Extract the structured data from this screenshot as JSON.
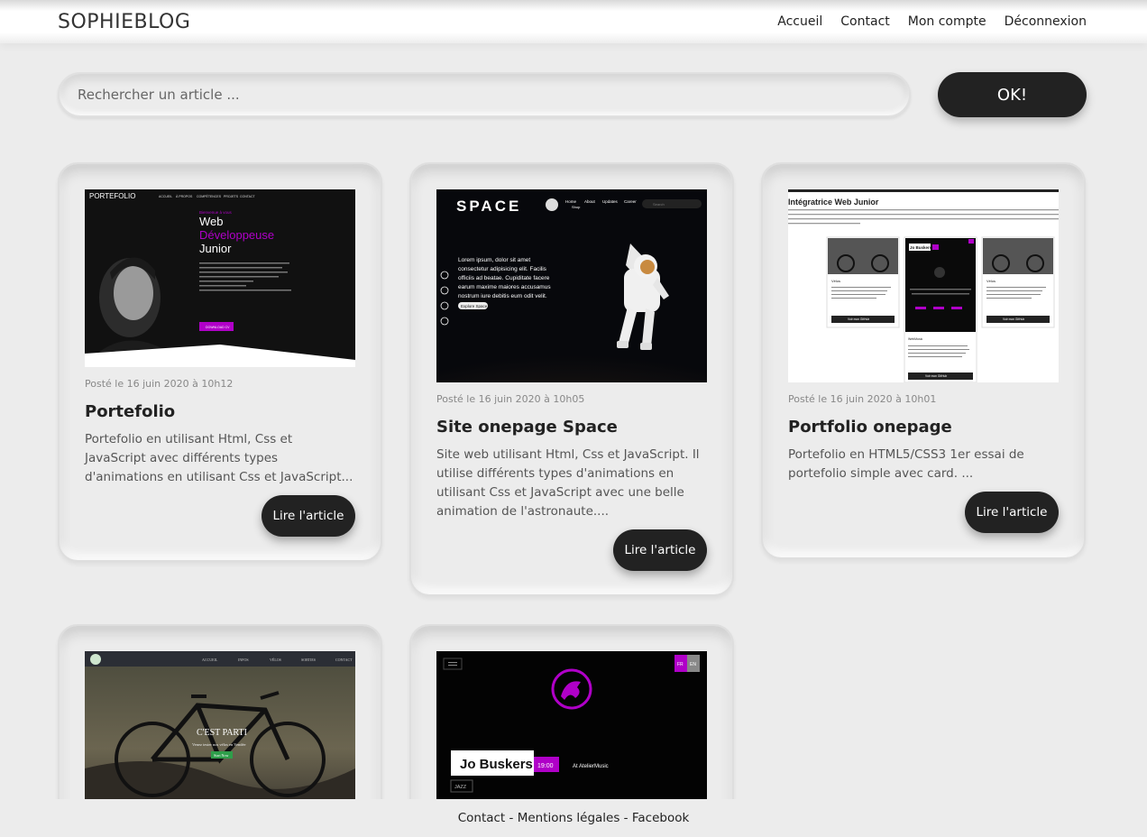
{
  "header": {
    "brand": "SOPHIEBLOG",
    "nav": [
      "Accueil",
      "Contact",
      "Mon compte",
      "Déconnexion"
    ]
  },
  "search": {
    "placeholder": "Rechercher un article ...",
    "button_label": "OK!"
  },
  "articles": [
    {
      "date": "Posté le 16 juin 2020 à 10h12",
      "title": "Portefolio",
      "excerpt": "Portefolio en utilisant Html, Css et JavaScript avec différents types d'animations en utilisant Css et JavaScript...",
      "read_label": "Lire l'article",
      "thumb": {
        "logo": "PORTEFOLIO",
        "menu": [
          "ACCUEIL",
          "À PROPOS",
          "COMPÉTENCES",
          "PROJETS",
          "CONTACT"
        ],
        "kicker": "Bienvenue à vous",
        "heading1": "Web",
        "heading2": "Développeuse",
        "heading3": "Junior",
        "button": "DOWNLOAD CV"
      }
    },
    {
      "date": "Posté le 16 juin 2020 à 10h05",
      "title": "Site onepage Space",
      "excerpt": "Site web utilisant Html, Css et JavaScript. Il utilise différents types d'animations en utilisant Css et JavaScript avec une belle animation de l'astronaute....",
      "read_label": "Lire l'article",
      "thumb": {
        "logo": "SPACE",
        "menu": [
          "Home",
          "About",
          "Updates",
          "Career",
          "Shop"
        ],
        "search": "Search",
        "text1": "Lorem ipsum, dolor sit amet",
        "text2": "consectetur adipisicing elit. Facilis",
        "text3": "officiis ad beatae. Cupiditate facere",
        "text4": "earum maxime maiores accusamus",
        "text5": "nostrum iure debitis eum odit velit.",
        "button": "Explore Space"
      }
    },
    {
      "date": "Posté le 16 juin 2020 à 10h01",
      "title": "Portfolio onepage",
      "excerpt": "Portefolio en HTML5/CSS3 1er essai de portefolio simple avec card. ...",
      "read_label": "Lire l'article",
      "thumb": {
        "heading": "Intégratrice Web Junior",
        "card_title": "Vélos",
        "card_center": "Jo Buskers",
        "card_center_title": "WebMusic",
        "button": "Voir mon GitHub"
      }
    },
    {
      "thumb": {
        "menu": [
          "ACCUEIL",
          "INFOS",
          "VÉLOS",
          "SORTIES",
          "CONTACT"
        ],
        "heading": "C'EST PARTI",
        "sub": "Venez tester nos vélos en Vendée",
        "button": "Start Now"
      }
    },
    {
      "thumb": {
        "lang1": "FR",
        "lang2": "EN",
        "name": "Jo Buskers",
        "time": "19:00",
        "venue": "At AtelierMusic",
        "genre": "JAZZ"
      }
    }
  ],
  "footer": {
    "links": [
      "Contact",
      "Mentions légales",
      "Facebook"
    ],
    "separator": " - "
  },
  "colors": {
    "accent_purple": "#b000c8",
    "dark": "#222222",
    "background": "#ececec"
  }
}
